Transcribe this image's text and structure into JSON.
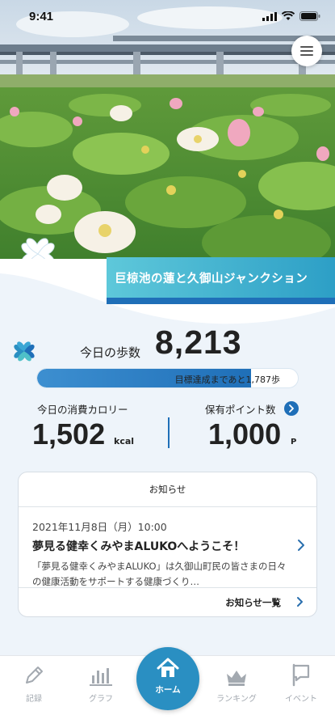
{
  "status_bar": {
    "time": "9:41"
  },
  "hero": {
    "location_title": "巨椋池の蓮と久御山ジャンクション"
  },
  "steps": {
    "label": "今日の歩数",
    "value": "8,213",
    "goal_remaining_text": "目標達成まであと1,787歩",
    "progress_fraction": 0.821
  },
  "calories": {
    "label": "今日の消費カロリー",
    "value": "1,502",
    "unit": "kcal"
  },
  "points": {
    "label": "保有ポイント数",
    "value": "1,000",
    "unit": "P"
  },
  "news": {
    "header": "お知らせ",
    "items": [
      {
        "date": "2021年11月8日（月）10:00",
        "title": "夢見る健幸くみやまALUKOへようこそ！",
        "body": "「夢見る健幸くみやまALUKO」は久御山町民の皆さまの日々の健康活動をサポートする健康づくり…"
      }
    ],
    "more_label": "お知らせ一覧"
  },
  "tabs": [
    {
      "label": "記録",
      "icon": "pencil-icon"
    },
    {
      "label": "グラフ",
      "icon": "bar-chart-icon"
    },
    {
      "label": "ホーム",
      "icon": "home-icon"
    },
    {
      "label": "ランキング",
      "icon": "crown-icon"
    },
    {
      "label": "イベント",
      "icon": "flag-icon"
    }
  ],
  "colors": {
    "accent": "#2a8fc2",
    "banner_gradient_start": "#5ec8da",
    "banner_gradient_end": "#2d9fc6",
    "progress_fill": "#1f6fb8",
    "tab_inactive": "#a3a9b0"
  }
}
